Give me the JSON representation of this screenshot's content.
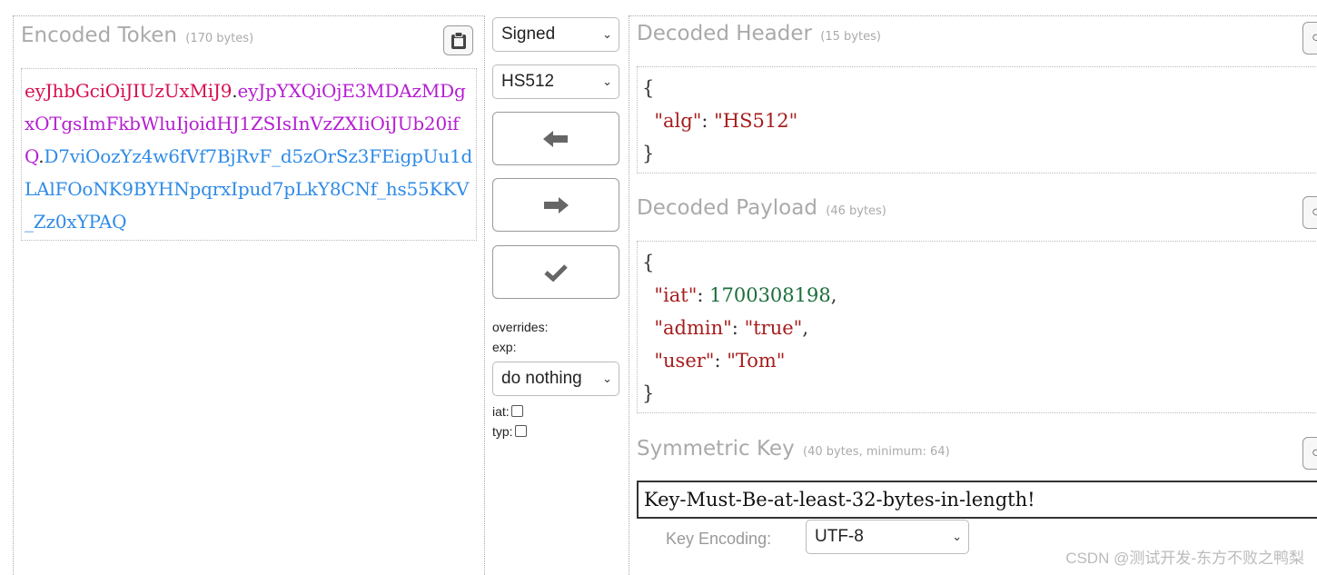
{
  "encoded": {
    "title": "Encoded Token",
    "bytes": "(170 bytes)",
    "token_header": "eyJhbGciOiJIUzUxMiJ9",
    "token_payload": "eyJpYXQiOjE3MDAzMDgxOTgsImFkbWluIjoidHJ1ZSIsInVzZXIiOiJUb20ifQ",
    "token_signature": "D7viOozYz4w6fVf7BjRvF_d5zOrSz3FEigpUu1dLAlFOoNK9BYHNpqrxIpud7pLkY8CNf_hs55KKV_Zz0xYPAQ",
    "dot": ".",
    "clipboard_icon": "clipboard-icon"
  },
  "controls": {
    "mode_select": "Signed",
    "alg_select": "HS512",
    "decode_icon": "arrow-left-icon",
    "encode_icon": "arrow-right-icon",
    "verify_icon": "checkmark-icon",
    "overrides_label": "overrides:",
    "exp_label": "exp:",
    "exp_select": "do nothing",
    "iat_label": "iat:",
    "typ_label": "typ:"
  },
  "header": {
    "title": "Decoded Header",
    "bytes": "(15 bytes)",
    "open": "{",
    "close": "}",
    "key_alg": "\"alg\"",
    "val_alg": "\"HS512\""
  },
  "payload": {
    "title": "Decoded Payload",
    "bytes": "(46 bytes)",
    "open": "{",
    "close": "}",
    "key_iat": "\"iat\"",
    "val_iat": "1700308198",
    "key_admin": "\"admin\"",
    "val_admin": "\"true\"",
    "key_user": "\"user\"",
    "val_user": "\"Tom\""
  },
  "symmetric": {
    "title": "Symmetric Key",
    "bytes": "(40 bytes, minimum: 64)",
    "key_value": "Key-Must-Be-at-least-32-bytes-in-length!",
    "encoding_label": "Key Encoding:",
    "encoding_select": "UTF-8"
  },
  "watermark": "CSDN @测试开发-东方不败之鸭梨"
}
